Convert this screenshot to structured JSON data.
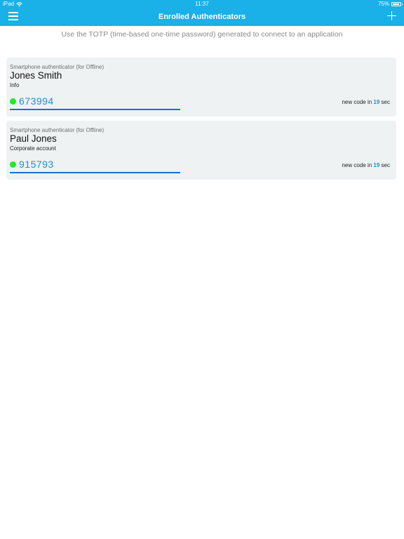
{
  "status_bar": {
    "device": "iPad",
    "time": "11:37",
    "battery": "75%"
  },
  "nav": {
    "title": "Enrolled Authenticators",
    "menu_icon": "hamburger-menu-icon",
    "add_icon": "plus-icon"
  },
  "instruction": "Use the TOTP (time-based one-time password) generated to connect to an application",
  "authenticators": [
    {
      "type": "Smartphone authenticator (for Offline)",
      "name": "Jones Smith",
      "subtitle": "Info",
      "code": "673994",
      "countdown_prefix": "new code in",
      "countdown_value": "19",
      "countdown_suffix": "sec"
    },
    {
      "type": "Smartphone authenticator (for Offline)",
      "name": "Paul Jones",
      "subtitle": "Corporate account",
      "code": "915793",
      "countdown_prefix": "new code in",
      "countdown_value": "19",
      "countdown_suffix": "sec"
    }
  ],
  "colors": {
    "header": "#1ab0e8",
    "card_background": "#eef2f3",
    "code": "#1f8fd6",
    "status_dot": "#26e82a",
    "underline": "#1a6fd8"
  }
}
